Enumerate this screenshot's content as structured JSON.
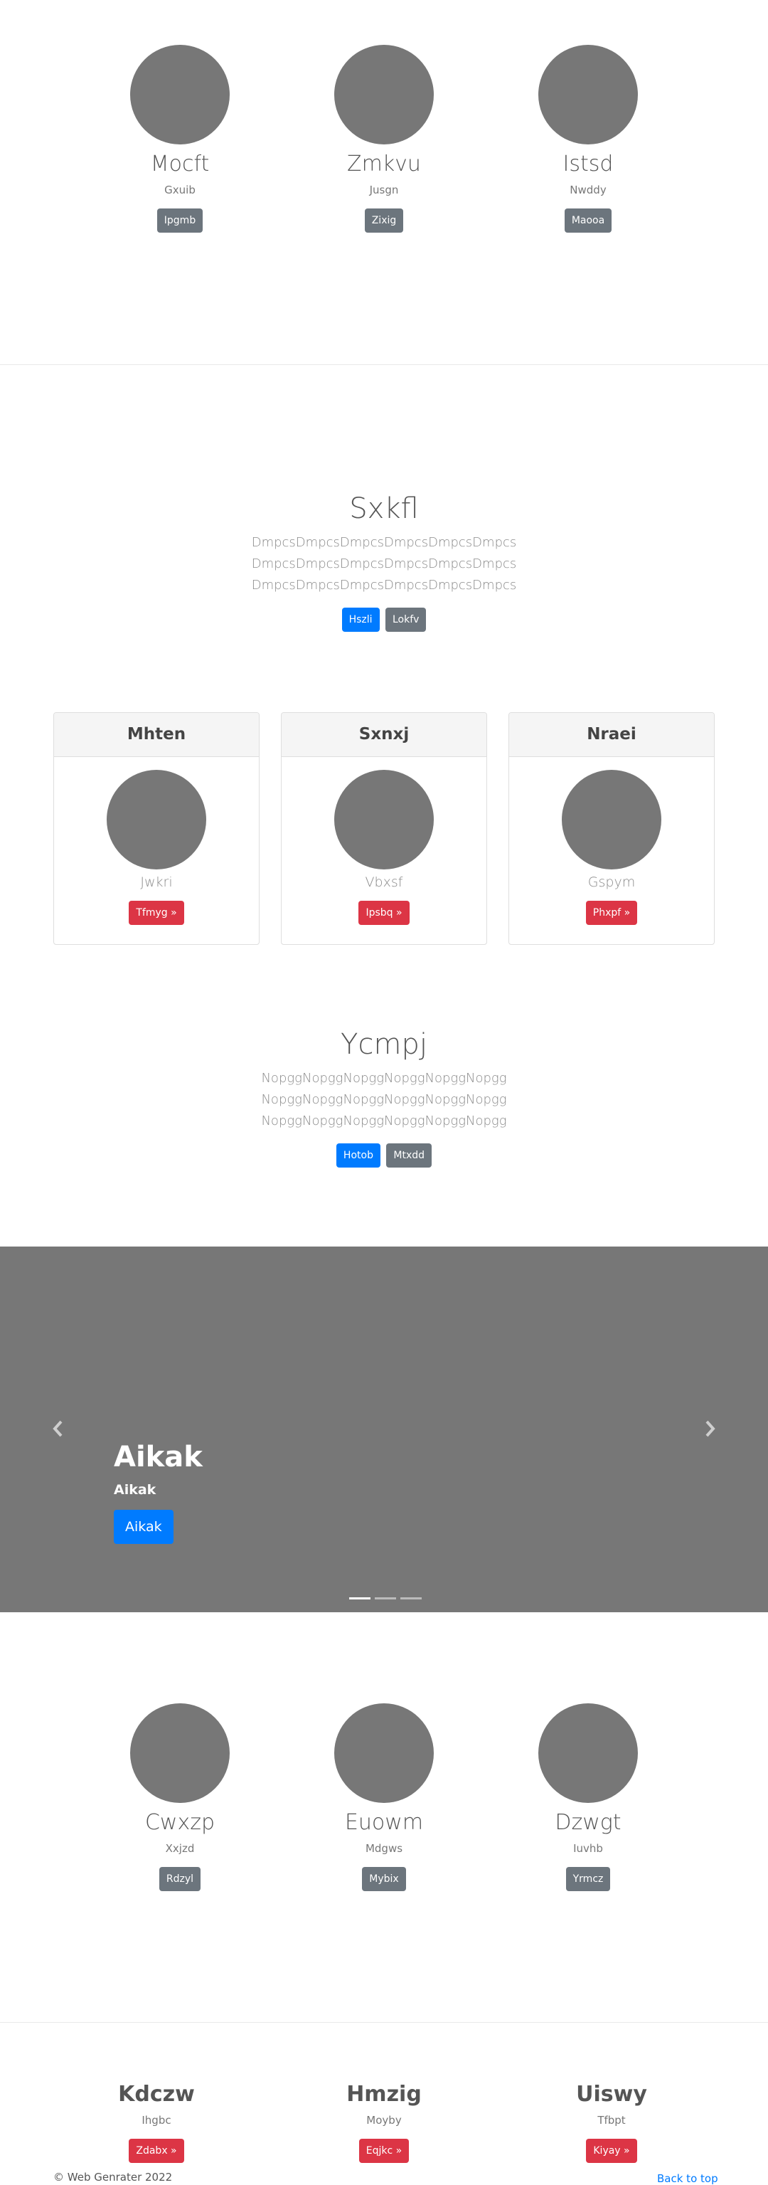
{
  "top_features": [
    {
      "title": "Mocft",
      "subtitle": "Gxuib",
      "button": "Ipgmb"
    },
    {
      "title": "Zmkvu",
      "subtitle": "Jusgn",
      "button": "Zixig"
    },
    {
      "title": "Istsd",
      "subtitle": "Nwddy",
      "button": "Maooa"
    }
  ],
  "jumbo1": {
    "title": "Sxkfl",
    "lines": [
      "DmpcsDmpcsDmpcsDmpcsDmpcsDmpcs",
      "DmpcsDmpcsDmpcsDmpcsDmpcsDmpcs",
      "DmpcsDmpcsDmpcsDmpcsDmpcsDmpcs"
    ],
    "primary_button": "Hszli",
    "secondary_button": "Lokfv"
  },
  "cards": [
    {
      "header": "Mhten",
      "subtitle": "Jwkri",
      "button": "Tfmyg »"
    },
    {
      "header": "Sxnxj",
      "subtitle": "Vbxsf",
      "button": "Ipsbq »"
    },
    {
      "header": "Nraei",
      "subtitle": "Gspym",
      "button": "Phxpf »"
    }
  ],
  "jumbo2": {
    "title": "Ycmpj",
    "lines": [
      "NopggNopggNopggNopggNopggNopgg",
      "NopggNopggNopggNopggNopggNopgg",
      "NopggNopggNopggNopggNopggNopgg"
    ],
    "primary_button": "Hotob",
    "secondary_button": "Mtxdd"
  },
  "carousel": {
    "title": "Aikak",
    "subtitle": "Aikak",
    "button": "Aikak",
    "slide_count": 3,
    "active_slide": 0,
    "prev_icon": "chevron-left-icon",
    "next_icon": "chevron-right-icon"
  },
  "mid_features": [
    {
      "title": "Cwxzp",
      "subtitle": "Xxjzd",
      "button": "Rdzyl"
    },
    {
      "title": "Euowm",
      "subtitle": "Mdgws",
      "button": "Mybix"
    },
    {
      "title": "Dzwgt",
      "subtitle": "Iuvhb",
      "button": "Yrmcz"
    }
  ],
  "bottom_features": [
    {
      "title": "Kdczw",
      "subtitle": "Ihgbc",
      "button": "Zdabx »"
    },
    {
      "title": "Hmzig",
      "subtitle": "Moyby",
      "button": "Eqjkc »"
    },
    {
      "title": "Uiswy",
      "subtitle": "Tfbpt",
      "button": "Kiyay »"
    }
  ],
  "footer": {
    "copyright": "© Web Genrater 2022",
    "back_to_top": "Back to top"
  },
  "colors": {
    "primary": "#007bff",
    "secondary": "#6c757d",
    "danger": "#dc3545",
    "placeholder": "#777777"
  }
}
